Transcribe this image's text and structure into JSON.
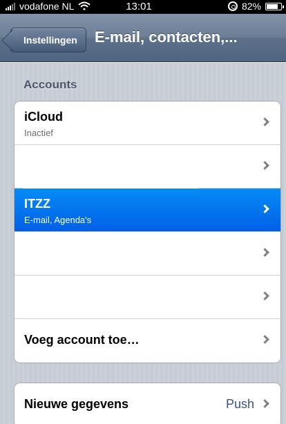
{
  "status_bar": {
    "carrier": "vodafone NL",
    "time": "13:01",
    "battery": "82%",
    "battery_level": 0.82
  },
  "nav": {
    "back_label": "Instellingen",
    "title": "E-mail, contacten,..."
  },
  "accounts": {
    "header": "Accounts",
    "rows": [
      {
        "title": "iCloud",
        "subtitle": "Inactief",
        "selected": false
      },
      {
        "title": "",
        "subtitle": "",
        "selected": false,
        "redacted": true
      },
      {
        "title": "ITZZ",
        "subtitle": "E-mail, Agenda's",
        "selected": true
      },
      {
        "title": "",
        "subtitle": "",
        "selected": false,
        "redacted": true
      },
      {
        "title": "",
        "subtitle": "",
        "selected": false,
        "redacted": true
      },
      {
        "title": "Voeg account toe…",
        "subtitle": "",
        "selected": false
      }
    ]
  },
  "fetch": {
    "label": "Nieuwe gegevens",
    "value": "Push"
  },
  "colors": {
    "selected_row": "#0a7bf0",
    "background": "#c5ccd4",
    "nav": "#6c7f97",
    "value_text": "#385487"
  }
}
